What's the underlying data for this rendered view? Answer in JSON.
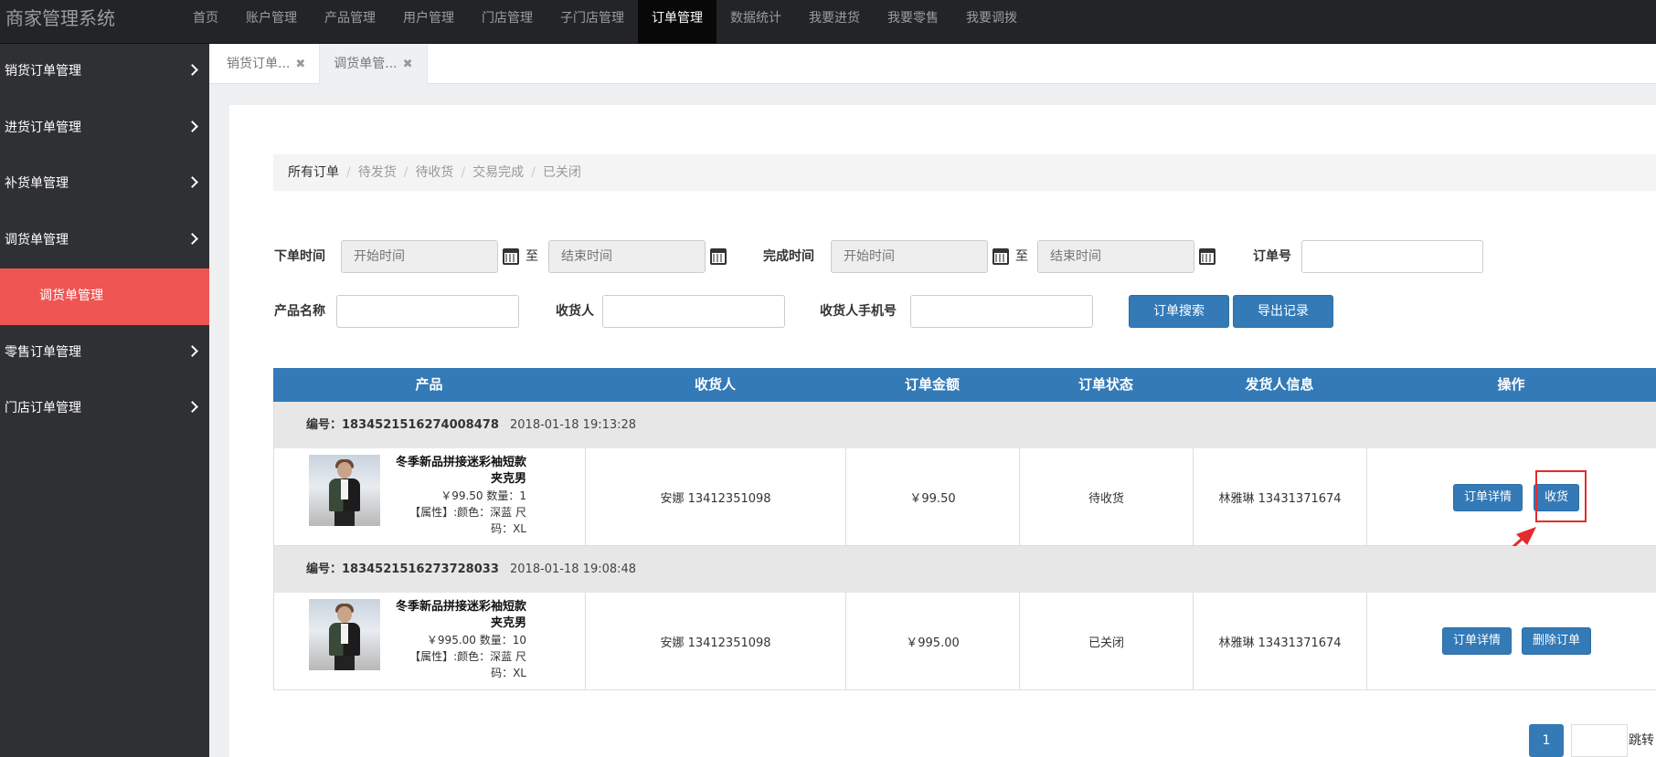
{
  "app": {
    "title": "商家管理系统"
  },
  "topnav": [
    "首页",
    "账户管理",
    "产品管理",
    "用户管理",
    "门店管理",
    "子门店管理",
    "订单管理",
    "数据统计",
    "我要进货",
    "我要零售",
    "我要调拨"
  ],
  "sidebar": {
    "items": [
      "销货订单管理",
      "进货订单管理",
      "补货单管理",
      "调货单管理"
    ],
    "sub_item": "调货单管理",
    "items_after": [
      "零售订单管理",
      "门店订单管理"
    ]
  },
  "tabs": [
    {
      "label": "销货订单...",
      "close": "✖"
    },
    {
      "label": "调货单管...",
      "close": "✖"
    }
  ],
  "breadcrumb": {
    "items": [
      "所有订单",
      "待发货",
      "待收货",
      "交易完成",
      "已关闭"
    ],
    "sep": "/"
  },
  "filters": {
    "order_time_label": "下单时间",
    "complete_time_label": "完成时间",
    "order_no_label": "订单号",
    "product_name_label": "产品名称",
    "receiver_label": "收货人",
    "receiver_phone_label": "收货人手机号",
    "start_placeholder": "开始时间",
    "end_placeholder": "结束时间",
    "to_text": "至",
    "search_btn": "订单搜索",
    "export_btn": "导出记录"
  },
  "table": {
    "headers": [
      "产品",
      "收货人",
      "订单金额",
      "订单状态",
      "发货人信息",
      "操作"
    ],
    "orders": [
      {
        "number": "编号：1834521516274008478",
        "time": "2018-01-18 19:13:28",
        "product_name": "冬季新品拼接迷彩袖短款夹克男",
        "price_qty": "￥99.50 数量：1",
        "attrs": "【属性】:颜色：深蓝 尺码：XL",
        "receiver": "安娜 13412351098",
        "amount": "￥99.50",
        "status": "待收货",
        "shipper": "林雅琳 13431371674",
        "actions": [
          "订单详情",
          "收货"
        ]
      },
      {
        "number": "编号：1834521516273728033",
        "time": "2018-01-18 19:08:48",
        "product_name": "冬季新品拼接迷彩袖短款夹克男",
        "price_qty": "￥995.00 数量：10",
        "attrs": "【属性】:颜色：深蓝 尺码：XL",
        "receiver": "安娜 13412351098",
        "amount": "￥995.00",
        "status": "已关闭",
        "shipper": "林雅琳 13431371674",
        "actions": [
          "订单详情",
          "删除订单"
        ]
      }
    ]
  },
  "pagination": {
    "current": "1",
    "jump_label": "跳转"
  },
  "colors": {
    "primary": "#337ab7",
    "active_side": "#ef5552",
    "highlight": "#e52b2b"
  }
}
